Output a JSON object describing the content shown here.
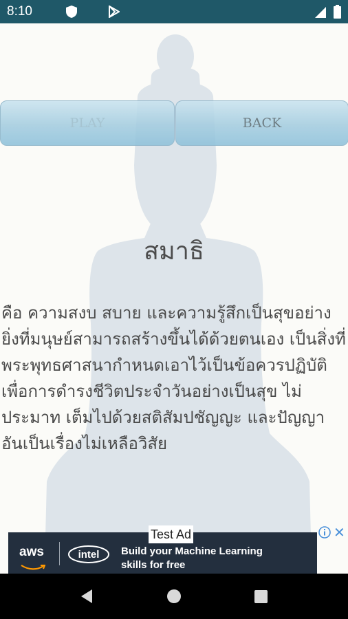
{
  "status_bar": {
    "time": "8:10",
    "icons": [
      "shield-icon",
      "play-store-icon",
      "signal-icon",
      "battery-icon"
    ],
    "background": "#1f5868"
  },
  "buttons": {
    "play_label": "PLAY",
    "back_label": "BACK"
  },
  "content": {
    "title": "สมาธิ",
    "body": "คือ ความสงบ สบาย และความรู้สึกเป็นสุขอย่างยิ่งที่มนุษย์สามารถสร้างขึ้นได้ด้วยตนเอง เป็นสิ่งที่พระพุทธศาสนากำหนดเอาไว้เป็นข้อควรปฏิบัติ เพื่อการดำรงชีวิตประจำวันอย่างเป็นสุข ไม่ประมาท เต็มไปด้วยสติสัมปชัญญะ และปัญญา อันเป็นเรื่องไม่เหลือวิสัย"
  },
  "ad": {
    "label": "Test Ad",
    "brand_aws": "aws",
    "brand_intel": "intel",
    "headline_line1": "Build your Machine Learning",
    "headline_line2": "skills for free",
    "background": "#232f3e"
  },
  "nav_bar": {
    "icons": [
      "back-icon",
      "home-icon",
      "recents-icon"
    ]
  }
}
